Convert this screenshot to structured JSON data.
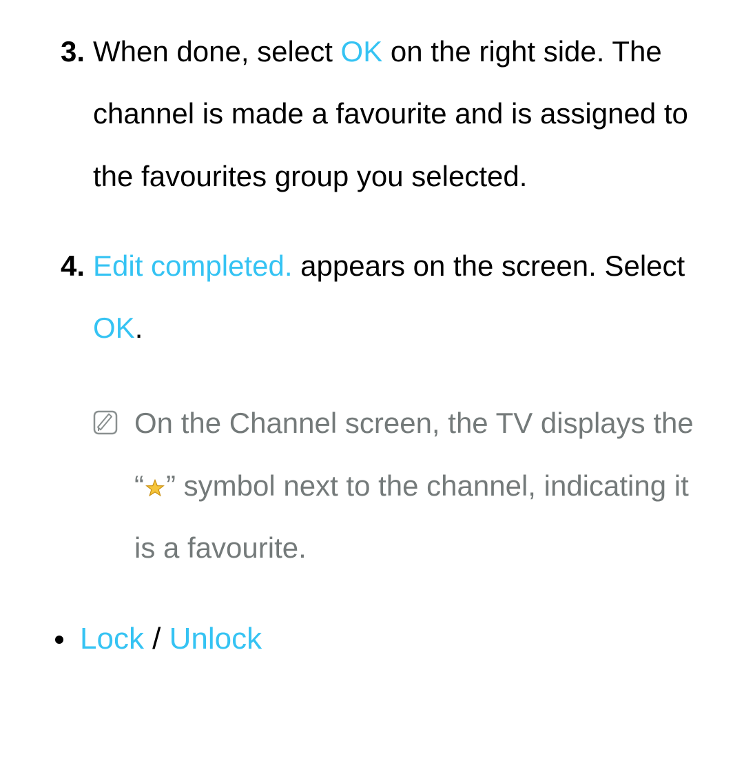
{
  "step3": {
    "number": "3.",
    "text_before": "When done, select ",
    "ok": "OK",
    "text_after": " on the right side. The channel is made a favourite and is assigned to the favourites group you selected."
  },
  "step4": {
    "number": "4.",
    "edit_completed": "Edit completed.",
    "text_mid": " appears on the screen. Select ",
    "ok": "OK",
    "period": "."
  },
  "note": {
    "before": "On the Channel screen, the TV displays the “",
    "after": "” symbol next to the channel, indicating it is a favourite."
  },
  "bullet": {
    "lock": "Lock",
    "sep": " / ",
    "unlock": "Unlock"
  }
}
